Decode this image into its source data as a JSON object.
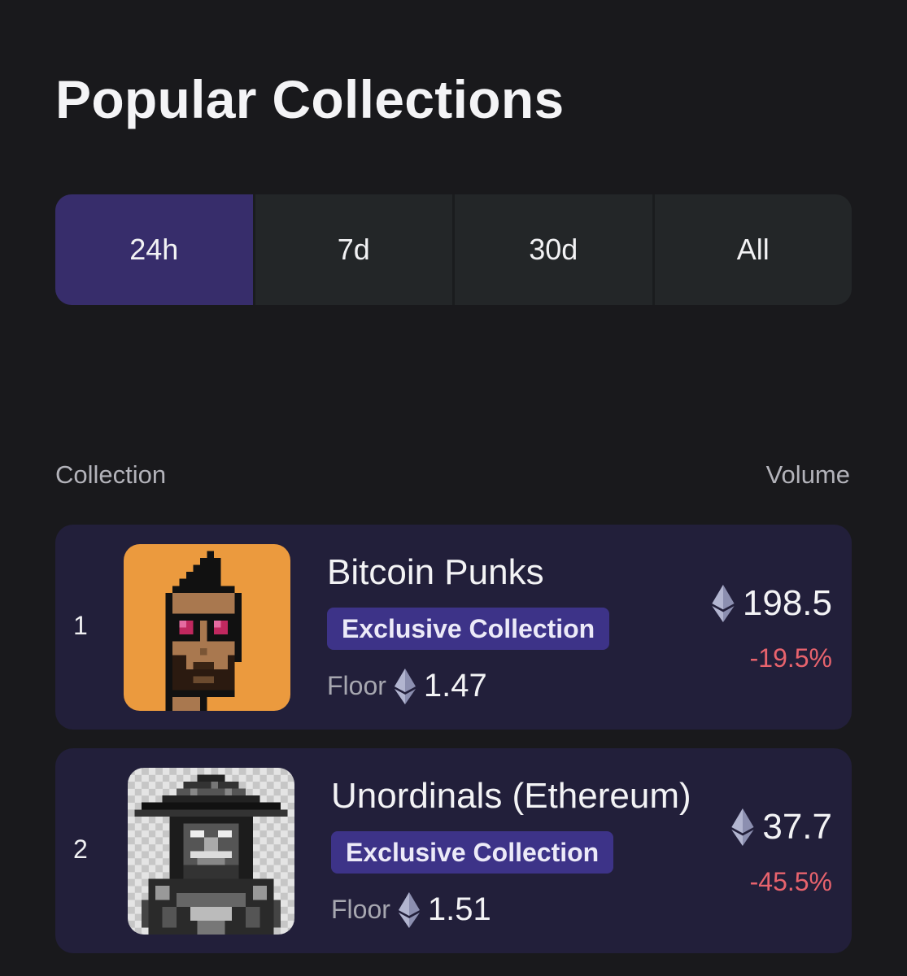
{
  "page": {
    "title": "Popular Collections"
  },
  "tabs": [
    {
      "label": "24h",
      "active": true
    },
    {
      "label": "7d",
      "active": false
    },
    {
      "label": "30d",
      "active": false
    },
    {
      "label": "All",
      "active": false
    }
  ],
  "table": {
    "col_collection": "Collection",
    "col_volume": "Volume",
    "rows": [
      {
        "rank": "1",
        "name": "Bitcoin Punks",
        "badge": "Exclusive Collection",
        "floor_label": "Floor",
        "floor_value": "1.47",
        "volume": "198.5",
        "change": "-19.5%",
        "thumbnail_icon": "bitcoin-punk-avatar"
      },
      {
        "rank": "2",
        "name": "Unordinals (Ethereum)",
        "badge": "Exclusive Collection",
        "floor_label": "Floor",
        "floor_value": "1.51",
        "volume": "37.7",
        "change": "-45.5%",
        "thumbnail_icon": "unordinals-avatar"
      }
    ]
  },
  "colors": {
    "background": "#19191c",
    "tab_active": "#372d6b",
    "tab_bg": "#232628",
    "row_bg": "#221f3a",
    "badge_bg": "#3d3388",
    "negative_change": "#e8636d",
    "punk_bg": "#eb9a3e"
  },
  "icons": {
    "currency": "ethereum-icon"
  }
}
